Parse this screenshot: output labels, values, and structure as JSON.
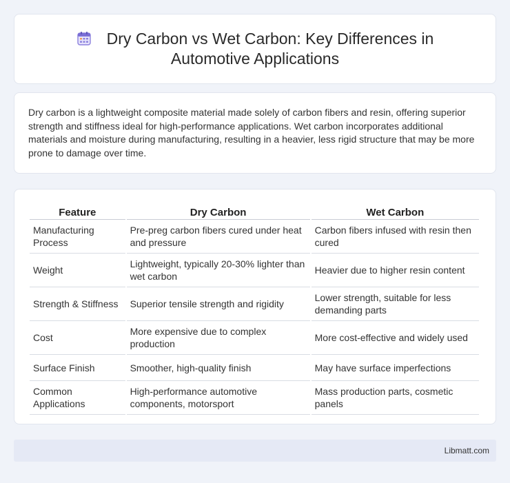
{
  "header": {
    "icon": "calendar-icon",
    "title": "Dry Carbon vs Wet Carbon: Key Differences in Automotive Applications"
  },
  "intro": {
    "text": "Dry carbon is a lightweight composite material made solely of carbon fibers and resin, offering superior strength and stiffness ideal for high-performance applications. Wet carbon incorporates additional materials and moisture during manufacturing, resulting in a heavier, less rigid structure that may be more prone to damage over time."
  },
  "table": {
    "headers": [
      "Feature",
      "Dry Carbon",
      "Wet Carbon"
    ],
    "rows": [
      [
        "Manufacturing Process",
        "Pre-preg carbon fibers cured under heat and pressure",
        "Carbon fibers infused with resin then cured"
      ],
      [
        "Weight",
        "Lightweight, typically 20-30% lighter than wet carbon",
        "Heavier due to higher resin content"
      ],
      [
        "Strength & Stiffness",
        "Superior tensile strength and rigidity",
        "Lower strength, suitable for less demanding parts"
      ],
      [
        "Cost",
        "More expensive due to complex production",
        "More cost-effective and widely used"
      ],
      [
        "Surface Finish",
        "Smoother, high-quality finish",
        "May have surface imperfections"
      ],
      [
        "Common Applications",
        "High-performance automotive components, motorsport",
        "Mass production parts, cosmetic panels"
      ]
    ]
  },
  "footer": {
    "site": "Libmatt.com"
  },
  "colors": {
    "background": "#f0f3f9",
    "card": "#ffffff",
    "footer_bg": "#e5e9f5",
    "icon_accent": "#7b6fd6"
  }
}
